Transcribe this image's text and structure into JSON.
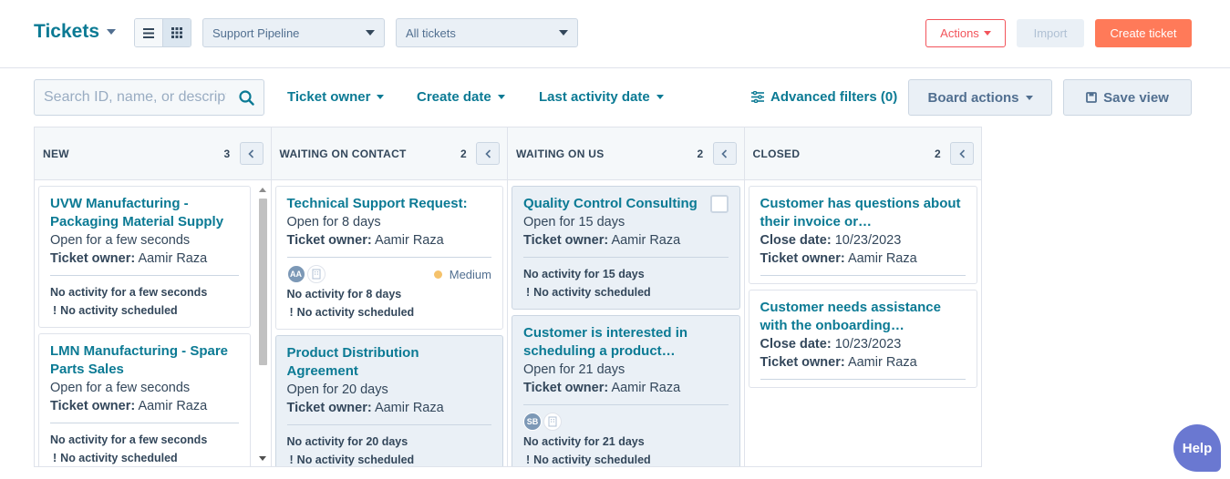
{
  "header": {
    "title": "Tickets",
    "pipeline_select": "Support Pipeline",
    "view_select": "All tickets",
    "actions_label": "Actions",
    "import_label": "Import",
    "create_label": "Create ticket"
  },
  "filters": {
    "search_placeholder": "Search ID, name, or description",
    "ticket_owner": "Ticket owner",
    "create_date": "Create date",
    "last_activity": "Last activity date",
    "advanced": "Advanced filters (0)",
    "board_actions": "Board actions",
    "save_view": "Save view"
  },
  "columns": [
    {
      "name": "NEW",
      "count": "3",
      "cards": [
        {
          "title": "UVW Manufacturing - Packaging Material Supply",
          "line1": "Open for a few seconds",
          "owner_label": "Ticket owner:",
          "owner": "Aamir Raza",
          "activity": "No activity for a few seconds",
          "scheduled": "No activity scheduled"
        },
        {
          "title": "LMN Manufacturing - Spare Parts Sales",
          "line1": "Open for a few seconds",
          "owner_label": "Ticket owner:",
          "owner": "Aamir Raza",
          "activity": "No activity for a few seconds",
          "scheduled": "No activity scheduled"
        }
      ]
    },
    {
      "name": "WAITING ON CONTACT",
      "count": "2",
      "cards": [
        {
          "title": "Technical Support Request:",
          "line1": "Open for 8 days",
          "owner_label": "Ticket owner:",
          "owner": "Aamir Raza",
          "avatar": "AA",
          "priority": "Medium",
          "activity": "No activity for 8 days",
          "scheduled": "No activity scheduled"
        },
        {
          "title": "Product Distribution Agreement",
          "line1": "Open for 20 days",
          "owner_label": "Ticket owner:",
          "owner": "Aamir Raza",
          "activity": "No activity for 20 days",
          "scheduled": "No activity scheduled"
        }
      ]
    },
    {
      "name": "WAITING ON US",
      "count": "2",
      "cards": [
        {
          "title": "Quality Control Consulting",
          "line1": "Open for 15 days",
          "owner_label": "Ticket owner:",
          "owner": "Aamir Raza",
          "activity": "No activity for 15 days",
          "scheduled": "No activity scheduled"
        },
        {
          "title": "Customer is interested in scheduling a product…",
          "line1": "Open for 21 days",
          "owner_label": "Ticket owner:",
          "owner": "Aamir Raza",
          "avatar": "SB",
          "activity": "No activity for 21 days",
          "scheduled": "No activity scheduled"
        }
      ]
    },
    {
      "name": "CLOSED",
      "count": "2",
      "cards": [
        {
          "title": "Customer has questions about their invoice or…",
          "close_label": "Close date:",
          "close_date": "10/23/2023",
          "owner_label": "Ticket owner:",
          "owner": "Aamir Raza"
        },
        {
          "title": "Customer needs assistance with the onboarding…",
          "close_label": "Close date:",
          "close_date": "10/23/2023",
          "owner_label": "Ticket owner:",
          "owner": "Aamir Raza"
        }
      ]
    }
  ],
  "help_label": "Help",
  "colors": {
    "brand": "#0b7a94",
    "primary_button": "#ff7a59",
    "danger_outline": "#f2545b",
    "help": "#6a78d1"
  }
}
